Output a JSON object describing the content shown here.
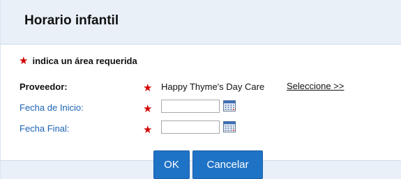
{
  "dialog": {
    "title": "Horario infantil"
  },
  "required_note": {
    "star": "★",
    "text": "indica un área requerida"
  },
  "form": {
    "provider": {
      "label": "Proveedor:",
      "star": "★",
      "value": "Happy Thyme's Day Care",
      "select_link": "Seleccione >>"
    },
    "start_date": {
      "label": "Fecha de Inicio:",
      "star": "★",
      "value": "",
      "placeholder": ""
    },
    "end_date": {
      "label": "Fecha Final:",
      "star": "★",
      "value": "",
      "placeholder": ""
    }
  },
  "buttons": {
    "ok": "OK",
    "cancel": "Cancelar"
  },
  "colors": {
    "accent": "#1f73c6",
    "required": "#d40000",
    "link": "#1b63b4",
    "header_bg": "#e9f0f8"
  }
}
